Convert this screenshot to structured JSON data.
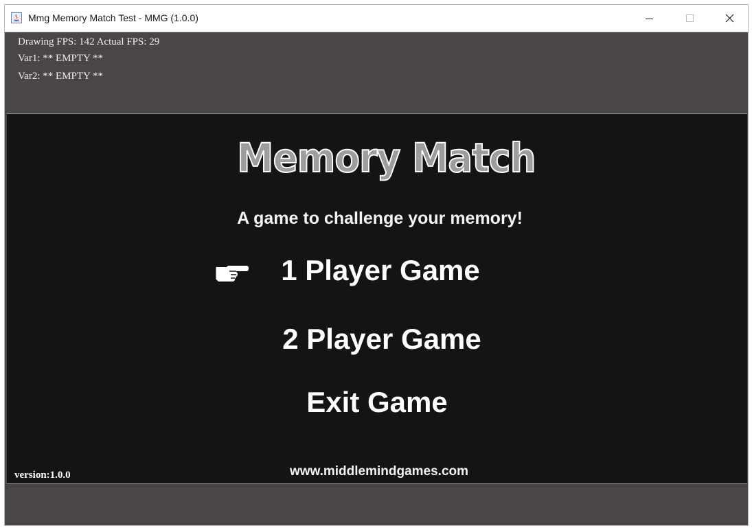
{
  "window": {
    "title": "Mmg Memory Match Test - MMG (1.0.0)",
    "icons": {
      "app": "java-app-icon",
      "minimize": "minimize-icon",
      "maximize": "maximize-icon",
      "close": "close-icon"
    }
  },
  "debug": {
    "line1": "Drawing FPS: 142 Actual FPS: 29",
    "line2": "Var1: ** EMPTY **",
    "line3": "Var2: ** EMPTY **"
  },
  "game": {
    "logo": "Memory Match",
    "subtitle": "A game to challenge your memory!",
    "menu": [
      {
        "label": "1 Player Game",
        "selected": true
      },
      {
        "label": "2 Player Game",
        "selected": false
      },
      {
        "label": "Exit Game",
        "selected": false
      }
    ],
    "pointer_icon": "pointing-hand-icon",
    "version": "version:1.0.0",
    "website": "www.middlemindgames.com"
  },
  "colors": {
    "frame": "#4b4646",
    "game_bg": "#141414",
    "text": "#ffffff"
  }
}
